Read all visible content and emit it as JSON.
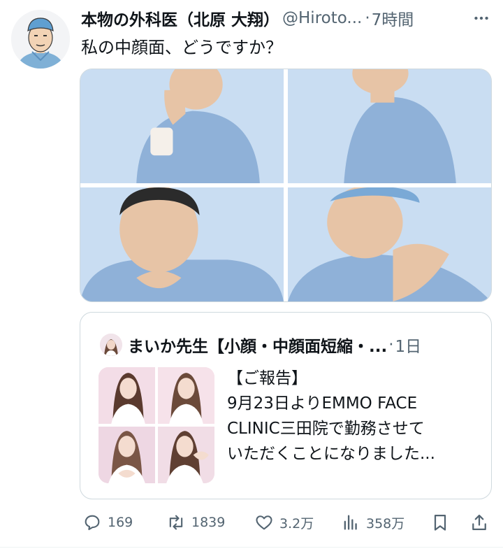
{
  "tweet": {
    "author_name": "本物の外科医（北原 大翔）",
    "handle": "@Hiroto...",
    "separator": "·",
    "time": "7時間",
    "text": "私の中顔面、どうですか？",
    "media_count": 4
  },
  "quote": {
    "author_name": "まいか先生【小顔・中顔面短縮・...",
    "separator": "·",
    "time": "1日",
    "text_lines": [
      "【ご報告】",
      "9月23日よりEMMO FACE",
      "CLINIC三田院で勤務させて",
      "いただくことになりました..."
    ]
  },
  "actions": {
    "replies": "169",
    "retweets": "1839",
    "likes": "3.2万",
    "views": "358万"
  },
  "icons": {
    "more": "more-horizontal-icon",
    "reply": "reply-icon",
    "retweet": "retweet-icon",
    "like": "heart-icon",
    "views": "views-bar-chart-icon",
    "bookmark": "bookmark-icon",
    "share": "share-icon"
  },
  "colors": {
    "text": "#0f1419",
    "secondary": "#536471",
    "border": "#cfd9de",
    "photo_background": "#c9ddf2",
    "scrub_blue": "#8fb1d8"
  }
}
